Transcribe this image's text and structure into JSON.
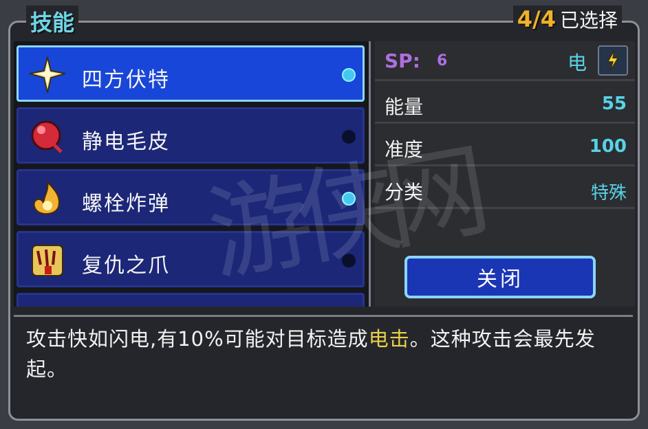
{
  "panel": {
    "title": "技能",
    "selected_count": "4/4",
    "selected_label": "已选择"
  },
  "skills": [
    {
      "name": "四方伏特",
      "icon": "lightning-star-icon",
      "equipped": true,
      "selected": true
    },
    {
      "name": "静电毛皮",
      "icon": "red-orb-icon",
      "equipped": false,
      "selected": false
    },
    {
      "name": "螺栓炸弹",
      "icon": "fire-swirl-icon",
      "equipped": true,
      "selected": false
    },
    {
      "name": "复仇之爪",
      "icon": "claw-icon",
      "equipped": false,
      "selected": false
    }
  ],
  "info": {
    "sp_label": "SP:",
    "sp_value": "6",
    "element": "电",
    "element_icon": "lightning-bolt-icon",
    "rows": [
      {
        "label": "能量",
        "value": "55"
      },
      {
        "label": "准度",
        "value": "100"
      },
      {
        "label": "分类",
        "value": "特殊"
      }
    ],
    "close_label": "关闭"
  },
  "description": {
    "before": "攻击快如闪电,有10%可能对目标造成",
    "highlight": "电击",
    "after": "。这种攻击会最先发起。"
  },
  "watermark": "游侠网",
  "colors": {
    "accent": "#58d3e6",
    "selected_bg": "#1846d8",
    "item_bg": "#1c2777",
    "sp": "#b06ee0",
    "count": "#f0b22a",
    "highlight": "#e8d24a"
  }
}
